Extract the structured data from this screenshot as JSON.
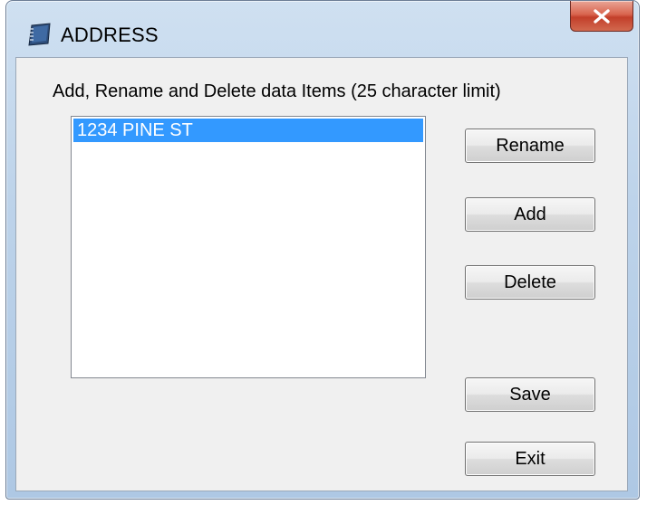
{
  "window": {
    "title": "ADDRESS",
    "icon": "notebook-icon",
    "close_icon": "close-icon"
  },
  "main": {
    "instructions": "Add, Rename and Delete data Items (25 character limit)",
    "list": {
      "items": [
        {
          "label": "1234 PINE ST",
          "selected": true
        }
      ]
    },
    "buttons": {
      "rename": "Rename",
      "add": "Add",
      "delete": "Delete",
      "save": "Save",
      "exit": "Exit"
    }
  },
  "colors": {
    "selection": "#3399ff",
    "close_button": "#c23f2a",
    "titlebar": "#bdd3ea",
    "client_background": "#f0f0f0"
  }
}
